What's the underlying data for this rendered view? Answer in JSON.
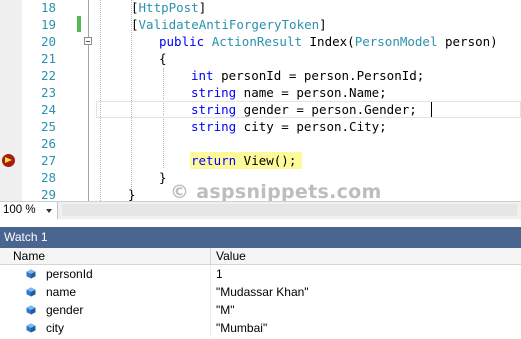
{
  "editor": {
    "line_numbers": [
      "18",
      "19",
      "20",
      "21",
      "22",
      "23",
      "24",
      "25",
      "26",
      "27",
      "28",
      "29"
    ],
    "lines": [
      {
        "segments": [
          {
            "t": "[",
            "c": ""
          },
          {
            "t": "HttpPost",
            "c": "attr"
          },
          {
            "t": "]",
            "c": ""
          }
        ]
      },
      {
        "segments": [
          {
            "t": "[",
            "c": ""
          },
          {
            "t": "ValidateAntiForgeryToken",
            "c": "attr"
          },
          {
            "t": "]",
            "c": ""
          }
        ]
      },
      {
        "segments": [
          {
            "t": "public ",
            "c": "kw"
          },
          {
            "t": "ActionResult",
            "c": "ty"
          },
          {
            "t": " Index(",
            "c": ""
          },
          {
            "t": "PersonModel",
            "c": "ty"
          },
          {
            "t": " person)",
            "c": ""
          }
        ]
      },
      {
        "segments": [
          {
            "t": "{",
            "c": ""
          }
        ]
      },
      {
        "segments": [
          {
            "t": "int",
            "c": "kw"
          },
          {
            "t": " personId = person.PersonId;",
            "c": ""
          }
        ]
      },
      {
        "segments": [
          {
            "t": "string",
            "c": "kw"
          },
          {
            "t": " name = person.Name;",
            "c": ""
          }
        ]
      },
      {
        "segments": [
          {
            "t": "string",
            "c": "kw"
          },
          {
            "t": " gender = person.Gender;",
            "c": ""
          }
        ]
      },
      {
        "segments": [
          {
            "t": "string",
            "c": "kw"
          },
          {
            "t": " city = person.City;",
            "c": ""
          }
        ]
      },
      {
        "segments": []
      },
      {
        "segments": [
          {
            "t": "return",
            "c": "kw"
          },
          {
            "t": " View();",
            "c": ""
          }
        ]
      },
      {
        "segments": [
          {
            "t": "}",
            "c": ""
          }
        ]
      },
      {
        "segments": [
          {
            "t": "}",
            "c": ""
          }
        ]
      }
    ],
    "watermark": "© aspsnippets.com"
  },
  "zoom": {
    "level": "100 %"
  },
  "watch": {
    "title": "Watch 1",
    "columns": {
      "name": "Name",
      "value": "Value"
    },
    "rows": [
      {
        "name": "personId",
        "value": "1"
      },
      {
        "name": "name",
        "value": "\"Mudassar Khan\""
      },
      {
        "name": "gender",
        "value": "\"M\""
      },
      {
        "name": "city",
        "value": "\"Mumbai\""
      }
    ]
  },
  "colors": {
    "keyword": "#0000ff",
    "type": "#2b91af",
    "watch_title_bg": "#4a6590",
    "breakpoint_highlight": "#fffa99"
  }
}
